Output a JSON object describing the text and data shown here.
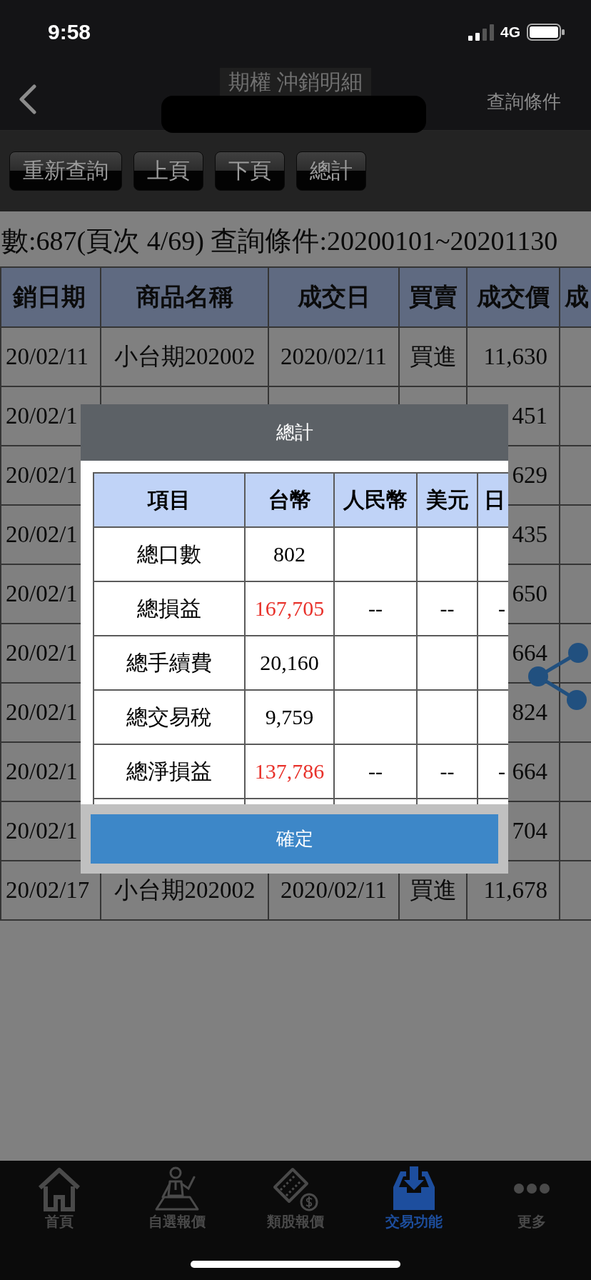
{
  "status_bar": {
    "time": "9:58",
    "network": "4G"
  },
  "nav_bar": {
    "title": "期權 沖銷明細",
    "action": "查詢條件"
  },
  "toolbar": {
    "buttons": [
      "重新查詢",
      "上頁",
      "下頁",
      "總計"
    ]
  },
  "summary": "數:687(頁次 4/69) 查詢條件:20200101~20201130",
  "table": {
    "columns": [
      "銷日期",
      "商品名稱",
      "成交日",
      "買賣",
      "成交價",
      "成"
    ],
    "rows": [
      {
        "column_1": "20/02/11",
        "product": "小台期202002",
        "trade_date": "2020/02/11",
        "side": "買進",
        "price": "11,630"
      },
      {
        "column_1": "20/02/1",
        "price": "451"
      },
      {
        "column_1": "20/02/1",
        "price": "629"
      },
      {
        "column_1": "20/02/1",
        "price": "435"
      },
      {
        "column_1": "20/02/1",
        "price": "650"
      },
      {
        "column_1": "20/02/1",
        "price": "664"
      },
      {
        "column_1": "20/02/1",
        "price": "824"
      },
      {
        "column_1": "20/02/1",
        "price": "664"
      },
      {
        "column_1": "20/02/1",
        "price": "704"
      },
      {
        "column_1": "20/02/17",
        "product": "小台期202002",
        "trade_date": "2020/02/11",
        "side": "買進",
        "price": "11,678"
      }
    ]
  },
  "dialog": {
    "title": "總計",
    "table": {
      "columns": [
        "項目",
        "台幣",
        "人民幣",
        "美元",
        "日"
      ],
      "rows": [
        {
          "item": "總口數",
          "twd": "802",
          "color": "#000000"
        },
        {
          "item": "總損益",
          "twd": "167,705",
          "cny": "--",
          "usd": "--",
          "column_5": "-",
          "color": "#e8322b"
        },
        {
          "item": "總手續費",
          "twd": "20,160",
          "color": "#000000"
        },
        {
          "item": "總交易稅",
          "twd": "9,759",
          "color": "#000000"
        },
        {
          "item": "總淨損益",
          "twd": "137,786",
          "cny": "--",
          "usd": "--",
          "column_5": "-",
          "color": "#e8322b"
        }
      ]
    },
    "button": "確定"
  },
  "tab_bar": {
    "tabs": [
      {
        "label": "首頁",
        "selected": false
      },
      {
        "label": "自選報價",
        "selected": false
      },
      {
        "label": "類股報價",
        "selected": false
      },
      {
        "label": "交易功能",
        "selected": true
      },
      {
        "label": "更多",
        "selected": false
      }
    ]
  }
}
